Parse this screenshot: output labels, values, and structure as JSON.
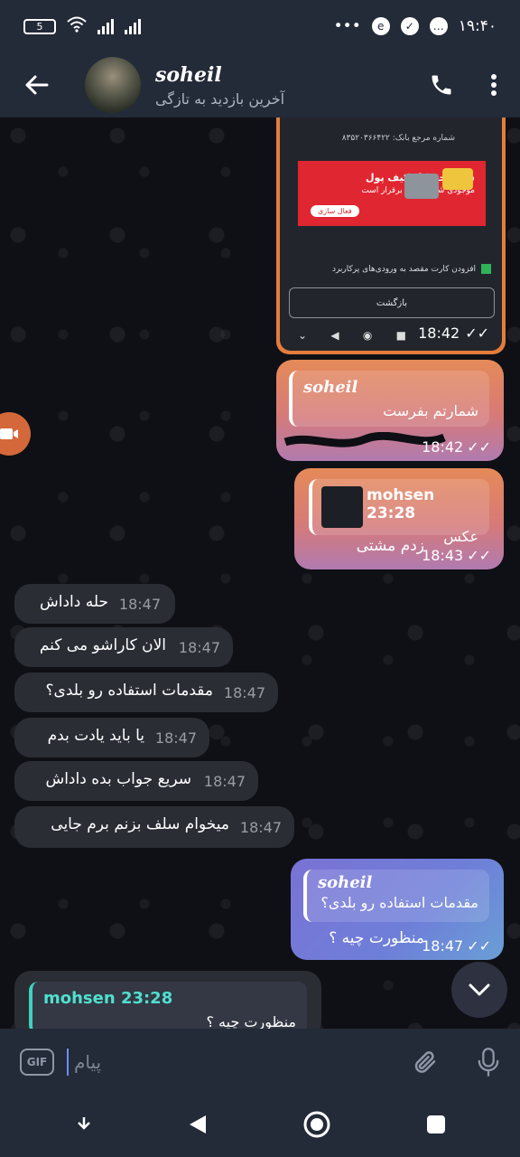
{
  "status_bar": {
    "time": "۱۹:۴۰",
    "battery": "5",
    "more": "•••"
  },
  "header": {
    "back_icon": "arrow-left-icon",
    "name": "soheil",
    "last_seen": "آخرین بازدید به تازگی",
    "call_icon": "phone-icon",
    "menu_icon": "more-vertical-icon"
  },
  "screenshot_message": {
    "ref_text": "شماره مرجع بانک: ۸۳۵۲۰۳۶۶۴۲۲",
    "banner_title": "شارژ خودکار کیف پول",
    "banner_subtitle": "موجودی شما همیشه برقرار است",
    "banner_button": "فعال سازی",
    "checkbox_text": "افزودن کارت مقصد به ورودی‌های پرکاربرد",
    "back_button": "بازگشت",
    "time": "18:42"
  },
  "messages": [
    {
      "id": "m1",
      "direction": "out",
      "reply_to_name": "soheil",
      "reply_to_text": "شمارتم بفرست",
      "text": "",
      "time": "18:42",
      "ticks": "✓✓"
    },
    {
      "id": "m2",
      "direction": "out",
      "reply_to_name": "mohsen 23:28",
      "reply_to_text": "عکس",
      "text": "زدم مشتی",
      "time": "18:43",
      "ticks": "✓✓"
    },
    {
      "id": "m3",
      "direction": "in",
      "text": "حله داداش",
      "time": "18:47"
    },
    {
      "id": "m4",
      "direction": "in",
      "text": "الان کاراشو می کنم",
      "time": "18:47"
    },
    {
      "id": "m5",
      "direction": "in",
      "text": "مقدمات استفاده رو بلدی؟",
      "time": "18:47"
    },
    {
      "id": "m6",
      "direction": "in",
      "text": "یا باید یادت بدم",
      "time": "18:47"
    },
    {
      "id": "m7",
      "direction": "in",
      "text": "سریع جواب بده داداش",
      "time": "18:47"
    },
    {
      "id": "m8",
      "direction": "in",
      "text": "میخوام سلف بزنم برم جایی",
      "time": "18:47"
    },
    {
      "id": "m9",
      "direction": "out",
      "reply_to_name": "soheil",
      "reply_to_text": "مقدمات استفاده رو بلدی؟",
      "text": "منظورت چیه ؟",
      "time": "18:47",
      "ticks": "✓✓"
    }
  ],
  "pending_reply": {
    "name": "mohsen 23:28",
    "text": "منظورت چیه ؟"
  },
  "input_bar": {
    "gif_label": "GIF",
    "placeholder": "پیام",
    "attach_icon": "paperclip-icon",
    "mic_icon": "microphone-icon"
  },
  "colors": {
    "accent_reply": "#3fd1c0",
    "bar_bg": "#232a38",
    "incoming_bg": "#2b2d35"
  }
}
